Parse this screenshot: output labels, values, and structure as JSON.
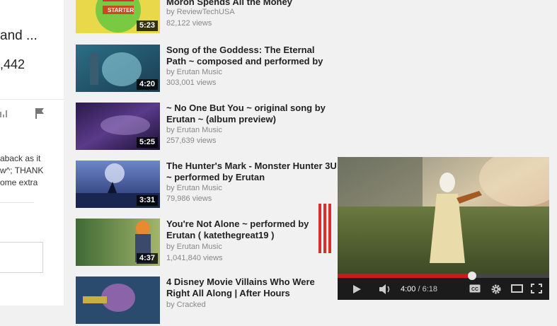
{
  "left_panel": {
    "title_fragment": "and ...",
    "views_fragment": ",442",
    "description_lines": [
      " aback as it",
      "w^; THANK",
      "ome extra"
    ]
  },
  "related": [
    {
      "title_lines": [
        "Moron Spends All the Money"
      ],
      "channel": "by ReviewTechUSA",
      "views": "82,122 views",
      "duration": "5:23",
      "thumb_badge": "STARTER"
    },
    {
      "title_lines": [
        "Song of the Goddess: The Eternal",
        "Path ~ composed and performed by"
      ],
      "channel": "by Erutan Music",
      "views": "303,001 views",
      "duration": "4:20"
    },
    {
      "title_lines": [
        "~ No One But You ~ original song by",
        "Erutan ~ (album preview)"
      ],
      "channel": "by Erutan Music",
      "views": "257,639 views",
      "duration": "5:25"
    },
    {
      "title_lines": [
        "The Hunter's Mark - Monster Hunter 3U",
        "~ performed by Erutan"
      ],
      "channel": "by Erutan Music",
      "views": "79,986 views",
      "duration": "3:31"
    },
    {
      "title_lines": [
        "You're Not Alone ~ performed by",
        "Erutan ( katethegreat19 )"
      ],
      "channel": "by Erutan Music",
      "views": "1,041,840 views",
      "duration": "4:37"
    },
    {
      "title_lines": [
        "4 Disney Movie Villains Who Were",
        "Right All Along | After Hours"
      ],
      "channel": "by Cracked",
      "views": "",
      "duration": ""
    }
  ],
  "player": {
    "current_time": "4:00",
    "separator": "/",
    "total_time": "6:18",
    "progress_fraction": 0.635
  },
  "colors": {
    "accent_red": "#cc181e",
    "page_bg": "#f1f1f1"
  }
}
